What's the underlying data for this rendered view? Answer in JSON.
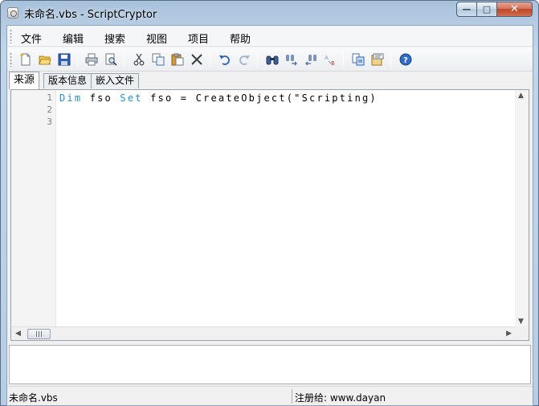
{
  "window": {
    "title": "未命名.vbs - ScriptCryptor",
    "minimize_glyph": "—",
    "maximize_glyph": "□",
    "close_glyph": "✕"
  },
  "menu": {
    "items": [
      {
        "label": "文件"
      },
      {
        "label": "编辑"
      },
      {
        "label": "搜索"
      },
      {
        "label": "视图"
      },
      {
        "label": "项目"
      },
      {
        "label": "帮助"
      }
    ]
  },
  "toolbar": {
    "buttons": [
      {
        "icon": "new-file-icon"
      },
      {
        "icon": "open-folder-icon"
      },
      {
        "icon": "save-icon"
      },
      {
        "icon": "print-icon"
      },
      {
        "icon": "print-preview-icon"
      },
      {
        "icon": "cut-icon"
      },
      {
        "icon": "copy-icon"
      },
      {
        "icon": "paste-icon"
      },
      {
        "icon": "delete-icon"
      },
      {
        "icon": "undo-icon"
      },
      {
        "icon": "redo-icon"
      },
      {
        "icon": "find-icon"
      },
      {
        "icon": "find-next-icon"
      },
      {
        "icon": "find-previous-icon"
      },
      {
        "icon": "replace-icon"
      },
      {
        "icon": "compile-icon"
      },
      {
        "icon": "project-settings-icon"
      },
      {
        "icon": "help-icon"
      }
    ]
  },
  "tabs": [
    {
      "label": "来源",
      "active": true
    },
    {
      "label": "版本信息",
      "active": false
    },
    {
      "label": "嵌入文件",
      "active": false
    }
  ],
  "editor": {
    "line_numbers": [
      "1",
      "2",
      "3"
    ],
    "line1": {
      "kw_dim": "Dim",
      "var1": " fso ",
      "kw_set": "Set",
      "rest": " fso = CreateObject(\"Scripting)"
    },
    "hscroll": {
      "left_arrow": "◀",
      "right_arrow": "▶"
    },
    "vscroll": {
      "up_arrow": "▲",
      "down_arrow": "▼"
    }
  },
  "status": {
    "file": "未命名.vbs",
    "registered": "注册给: www.dayan"
  },
  "colors": {
    "keyword": "#1e90d6",
    "title_bar": "#a9c2dc",
    "close_button": "#bf4526"
  }
}
